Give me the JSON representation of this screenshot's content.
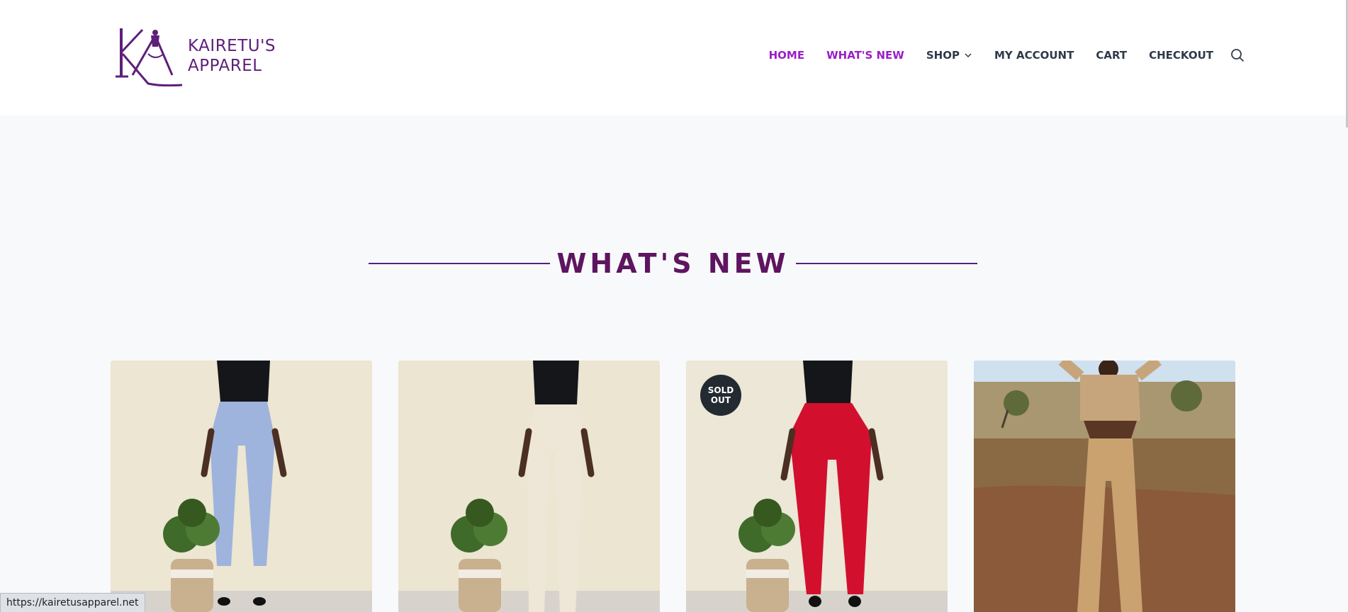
{
  "brand": {
    "line1": "KAIRETU'S",
    "line2": "APPAREL",
    "color": "#5e1f7a"
  },
  "nav": {
    "items": [
      {
        "label": "HOME",
        "active": true
      },
      {
        "label": "WHAT'S NEW",
        "active": true
      },
      {
        "label": "SHOP",
        "has_dropdown": true
      },
      {
        "label": "MY ACCOUNT"
      },
      {
        "label": "CART"
      },
      {
        "label": "CHECKOUT"
      }
    ],
    "search_icon": "search-icon",
    "active_color": "#9b1ec9",
    "text_color": "#2e3a4b"
  },
  "section": {
    "title": "WHAT'S NEW",
    "title_color": "#5e1560"
  },
  "products": [
    {
      "image": "woman in black top and light blue wide-leg trousers beside potted plant",
      "badge": ""
    },
    {
      "image": "woman in black top and cream wide-leg trousers beside potted plant",
      "badge": ""
    },
    {
      "image": "woman in black top and red wide-leg trousers beside potted plant",
      "badge": "SOLD OUT"
    },
    {
      "image": "woman in tan crop top and cargo trousers on savanna",
      "badge": ""
    }
  ],
  "status_bar": {
    "url": "https://kairetusapparel.net"
  }
}
